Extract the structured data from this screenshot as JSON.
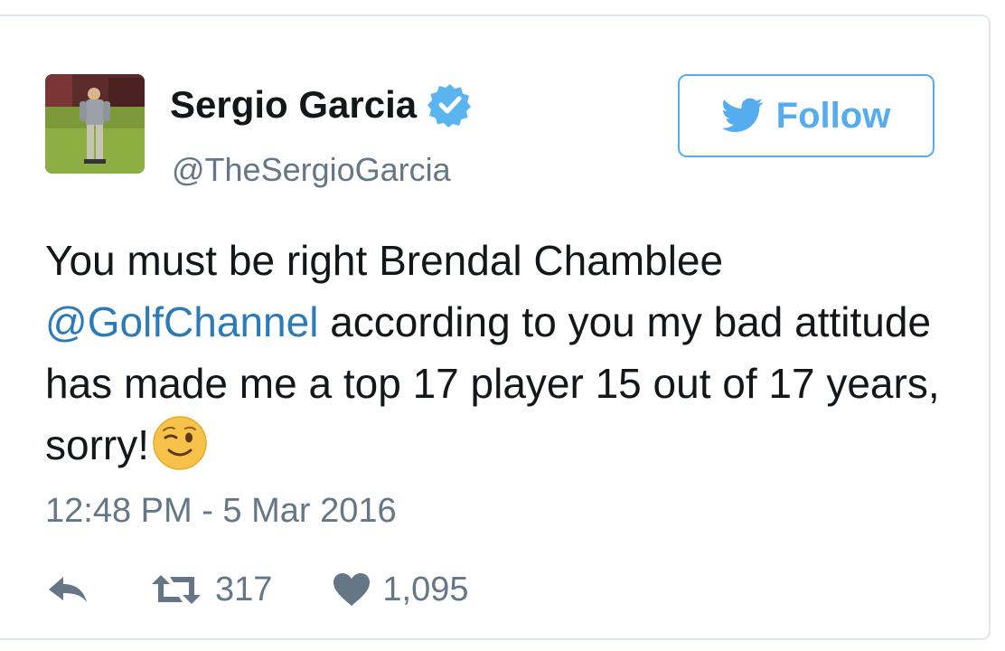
{
  "tweet": {
    "author": {
      "name": "Sergio Garcia",
      "handle": "@TheSergioGarcia",
      "verified": true,
      "avatar_icon": "golfer-photo"
    },
    "follow_button": {
      "label": "Follow",
      "icon": "twitter-bird-icon"
    },
    "text": {
      "line_segment_1": "You must be right Brendal Chamblee",
      "mention": "@GolfChannel",
      "line_segment_2": " according to you my bad attitude has made me a top 17 player 15 out of 17 years, sorry!",
      "emoji": "winking-face"
    },
    "timestamp": "12:48 PM - 5 Mar 2016",
    "stats": {
      "retweets": "317",
      "likes": "1,095"
    }
  },
  "colors": {
    "twitter_blue": "#55acee",
    "link_blue": "#2b7bb9",
    "text_primary": "#14171a",
    "text_secondary": "#657786",
    "border": "#e1e8ed"
  }
}
